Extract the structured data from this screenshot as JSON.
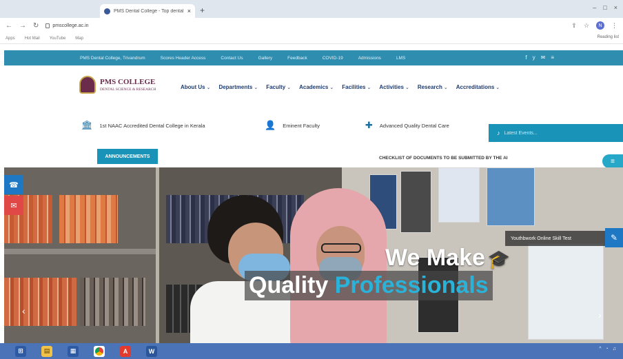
{
  "browser": {
    "tab_title": "PMS Dental College - Top dental...",
    "tab_close": "×",
    "new_tab": "+",
    "url": "pmscollege.ac.in",
    "bookmarks": [
      "Apps",
      "Hot Mail",
      "YouTube",
      "Map"
    ],
    "reading_list": "Reading list",
    "profile_initial": "N",
    "window_controls": [
      "–",
      "□",
      "×"
    ]
  },
  "topbar": {
    "links": [
      "PMS Dental College, Trivandrum",
      "Scores Header Access",
      "Contact Us",
      "Gallery",
      "Feedback",
      "COVID-19",
      "Admissions",
      "LMS"
    ]
  },
  "socials": [
    "f",
    "y",
    "✉",
    "≡"
  ],
  "header": {
    "brand_title": "PMS COLLEGE",
    "brand_sub": "DENTAL SCIENCE & RESEARCH",
    "menu": [
      "About Us",
      "Departments",
      "Faculty",
      "Academics",
      "Facilities",
      "Activities",
      "Research",
      "Accreditations"
    ]
  },
  "features": {
    "f1": "1st NAAC Accredited Dental College in Kerala",
    "f2": "Eminent Faculty",
    "f3": "Advanced Quality Dental Care",
    "cta": "Latest Events..."
  },
  "announce": {
    "label": "ANNOUNCEMENTS",
    "ticker": "CHECKLIST OF DOCUMENTS TO BE SUBMITTED BY THE AI"
  },
  "hero": {
    "headline1": "We Make",
    "headline2a": "Quality ",
    "headline2b": "Professionals",
    "skilltest": "Youthbwork Online Skill Test"
  },
  "colors": {
    "topbar": "#2f8db0",
    "accent": "#1a93b8",
    "menu_text": "#1f3b70",
    "highlight": "#2bb2d8"
  }
}
